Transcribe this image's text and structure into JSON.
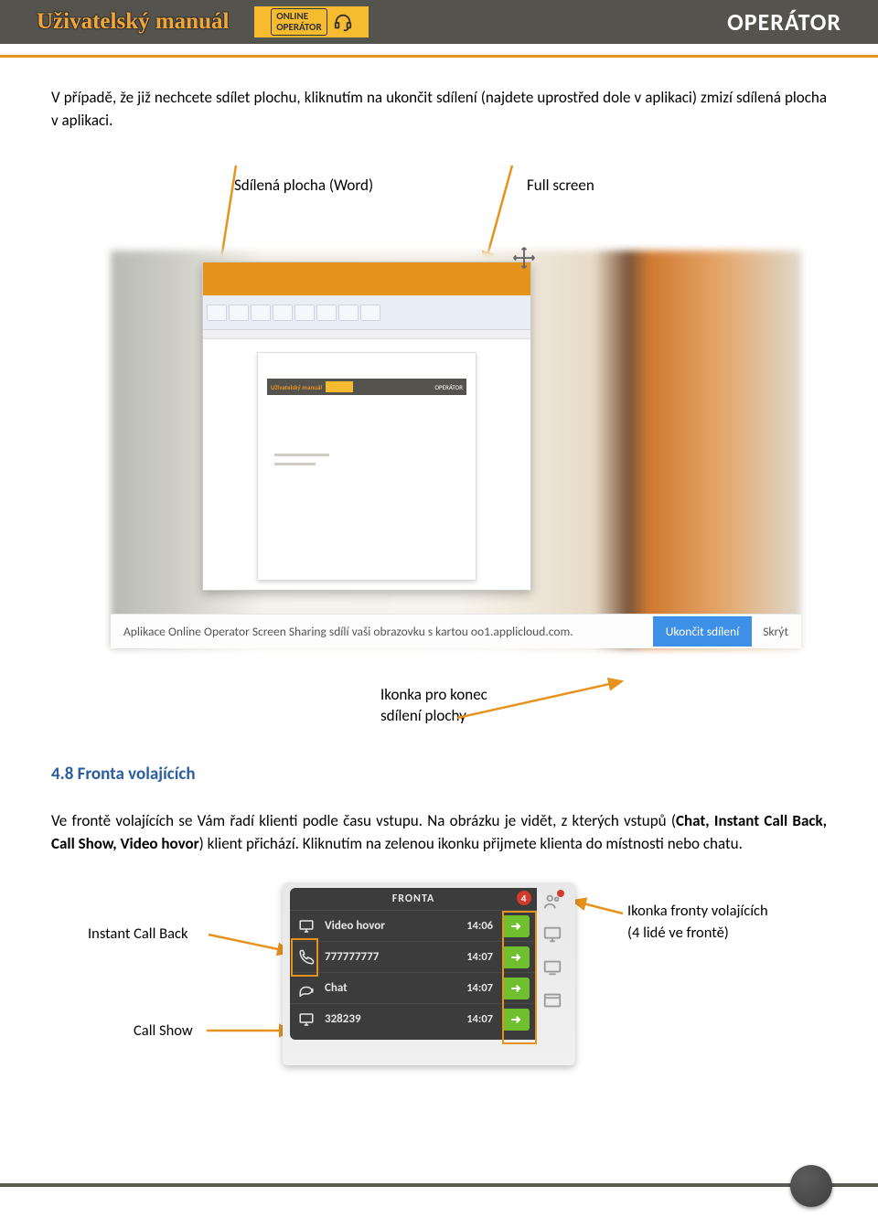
{
  "header": {
    "title": "Uživatelský manuál",
    "badge_line1": "ONLINE",
    "badge_line2": "OPERÁTOR",
    "right": "OPERÁTOR"
  },
  "intro_paragraph": "V případě, že již nechcete sdílet plochu, kliknutím na ukončit sdílení (najdete uprostřed dole v aplikaci) zmizí sdílená plocha v aplikaci.",
  "annot": {
    "shared_word": "Sdílená plocha (Word)",
    "full_screen": "Full screen",
    "stop_icon_l1": "Ikonka pro konec",
    "stop_icon_l2": "sdílení plochy"
  },
  "mini": {
    "title": "Uživatelský manuál",
    "right": "OPERÁTOR"
  },
  "chromebar": {
    "info": "Aplikace Online Operator Screen Sharing sdílí vaši obrazovku s kartou oo1.applicloud.com.",
    "stop": "Ukončit sdílení",
    "hide": "Skrýt"
  },
  "section_heading": "4.8 Fronta volajících",
  "para2_a": "Ve frontě volajících se Vám řadí klienti podle času vstupu. Na obrázku je vidět, z kterých vstupů (",
  "para2_b1": "Chat, Instant Call Back, Call Show, Video hovor",
  "para2_c": ") klient přichází. Kliknutím na zelenou ikonku přijmete klienta do místnosti nebo chatu.",
  "fronta": {
    "head": "FRONTA",
    "badge": "4",
    "rows": [
      {
        "icon": "monitor",
        "label": "Video hovor",
        "time": "14:06"
      },
      {
        "icon": "phone",
        "label": "777777777",
        "time": "14:07"
      },
      {
        "icon": "chat",
        "label": "Chat",
        "time": "14:07"
      },
      {
        "icon": "monitor",
        "label": "328239",
        "time": "14:07"
      }
    ]
  },
  "fl": {
    "left1": "Instant Call Back",
    "left2": "Call Show",
    "right": "Ikonka fronty volajících (4 lidé ve frontě)"
  }
}
